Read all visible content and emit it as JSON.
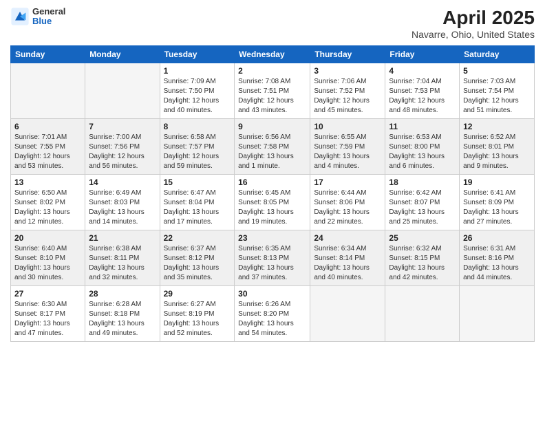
{
  "logo": {
    "general": "General",
    "blue": "Blue"
  },
  "title": "April 2025",
  "subtitle": "Navarre, Ohio, United States",
  "days_header": [
    "Sunday",
    "Monday",
    "Tuesday",
    "Wednesday",
    "Thursday",
    "Friday",
    "Saturday"
  ],
  "weeks": [
    [
      {
        "day": "",
        "info": ""
      },
      {
        "day": "",
        "info": ""
      },
      {
        "day": "1",
        "info": "Sunrise: 7:09 AM\nSunset: 7:50 PM\nDaylight: 12 hours and 40 minutes."
      },
      {
        "day": "2",
        "info": "Sunrise: 7:08 AM\nSunset: 7:51 PM\nDaylight: 12 hours and 43 minutes."
      },
      {
        "day": "3",
        "info": "Sunrise: 7:06 AM\nSunset: 7:52 PM\nDaylight: 12 hours and 45 minutes."
      },
      {
        "day": "4",
        "info": "Sunrise: 7:04 AM\nSunset: 7:53 PM\nDaylight: 12 hours and 48 minutes."
      },
      {
        "day": "5",
        "info": "Sunrise: 7:03 AM\nSunset: 7:54 PM\nDaylight: 12 hours and 51 minutes."
      }
    ],
    [
      {
        "day": "6",
        "info": "Sunrise: 7:01 AM\nSunset: 7:55 PM\nDaylight: 12 hours and 53 minutes."
      },
      {
        "day": "7",
        "info": "Sunrise: 7:00 AM\nSunset: 7:56 PM\nDaylight: 12 hours and 56 minutes."
      },
      {
        "day": "8",
        "info": "Sunrise: 6:58 AM\nSunset: 7:57 PM\nDaylight: 12 hours and 59 minutes."
      },
      {
        "day": "9",
        "info": "Sunrise: 6:56 AM\nSunset: 7:58 PM\nDaylight: 13 hours and 1 minute."
      },
      {
        "day": "10",
        "info": "Sunrise: 6:55 AM\nSunset: 7:59 PM\nDaylight: 13 hours and 4 minutes."
      },
      {
        "day": "11",
        "info": "Sunrise: 6:53 AM\nSunset: 8:00 PM\nDaylight: 13 hours and 6 minutes."
      },
      {
        "day": "12",
        "info": "Sunrise: 6:52 AM\nSunset: 8:01 PM\nDaylight: 13 hours and 9 minutes."
      }
    ],
    [
      {
        "day": "13",
        "info": "Sunrise: 6:50 AM\nSunset: 8:02 PM\nDaylight: 13 hours and 12 minutes."
      },
      {
        "day": "14",
        "info": "Sunrise: 6:49 AM\nSunset: 8:03 PM\nDaylight: 13 hours and 14 minutes."
      },
      {
        "day": "15",
        "info": "Sunrise: 6:47 AM\nSunset: 8:04 PM\nDaylight: 13 hours and 17 minutes."
      },
      {
        "day": "16",
        "info": "Sunrise: 6:45 AM\nSunset: 8:05 PM\nDaylight: 13 hours and 19 minutes."
      },
      {
        "day": "17",
        "info": "Sunrise: 6:44 AM\nSunset: 8:06 PM\nDaylight: 13 hours and 22 minutes."
      },
      {
        "day": "18",
        "info": "Sunrise: 6:42 AM\nSunset: 8:07 PM\nDaylight: 13 hours and 25 minutes."
      },
      {
        "day": "19",
        "info": "Sunrise: 6:41 AM\nSunset: 8:09 PM\nDaylight: 13 hours and 27 minutes."
      }
    ],
    [
      {
        "day": "20",
        "info": "Sunrise: 6:40 AM\nSunset: 8:10 PM\nDaylight: 13 hours and 30 minutes."
      },
      {
        "day": "21",
        "info": "Sunrise: 6:38 AM\nSunset: 8:11 PM\nDaylight: 13 hours and 32 minutes."
      },
      {
        "day": "22",
        "info": "Sunrise: 6:37 AM\nSunset: 8:12 PM\nDaylight: 13 hours and 35 minutes."
      },
      {
        "day": "23",
        "info": "Sunrise: 6:35 AM\nSunset: 8:13 PM\nDaylight: 13 hours and 37 minutes."
      },
      {
        "day": "24",
        "info": "Sunrise: 6:34 AM\nSunset: 8:14 PM\nDaylight: 13 hours and 40 minutes."
      },
      {
        "day": "25",
        "info": "Sunrise: 6:32 AM\nSunset: 8:15 PM\nDaylight: 13 hours and 42 minutes."
      },
      {
        "day": "26",
        "info": "Sunrise: 6:31 AM\nSunset: 8:16 PM\nDaylight: 13 hours and 44 minutes."
      }
    ],
    [
      {
        "day": "27",
        "info": "Sunrise: 6:30 AM\nSunset: 8:17 PM\nDaylight: 13 hours and 47 minutes."
      },
      {
        "day": "28",
        "info": "Sunrise: 6:28 AM\nSunset: 8:18 PM\nDaylight: 13 hours and 49 minutes."
      },
      {
        "day": "29",
        "info": "Sunrise: 6:27 AM\nSunset: 8:19 PM\nDaylight: 13 hours and 52 minutes."
      },
      {
        "day": "30",
        "info": "Sunrise: 6:26 AM\nSunset: 8:20 PM\nDaylight: 13 hours and 54 minutes."
      },
      {
        "day": "",
        "info": ""
      },
      {
        "day": "",
        "info": ""
      },
      {
        "day": "",
        "info": ""
      }
    ]
  ]
}
